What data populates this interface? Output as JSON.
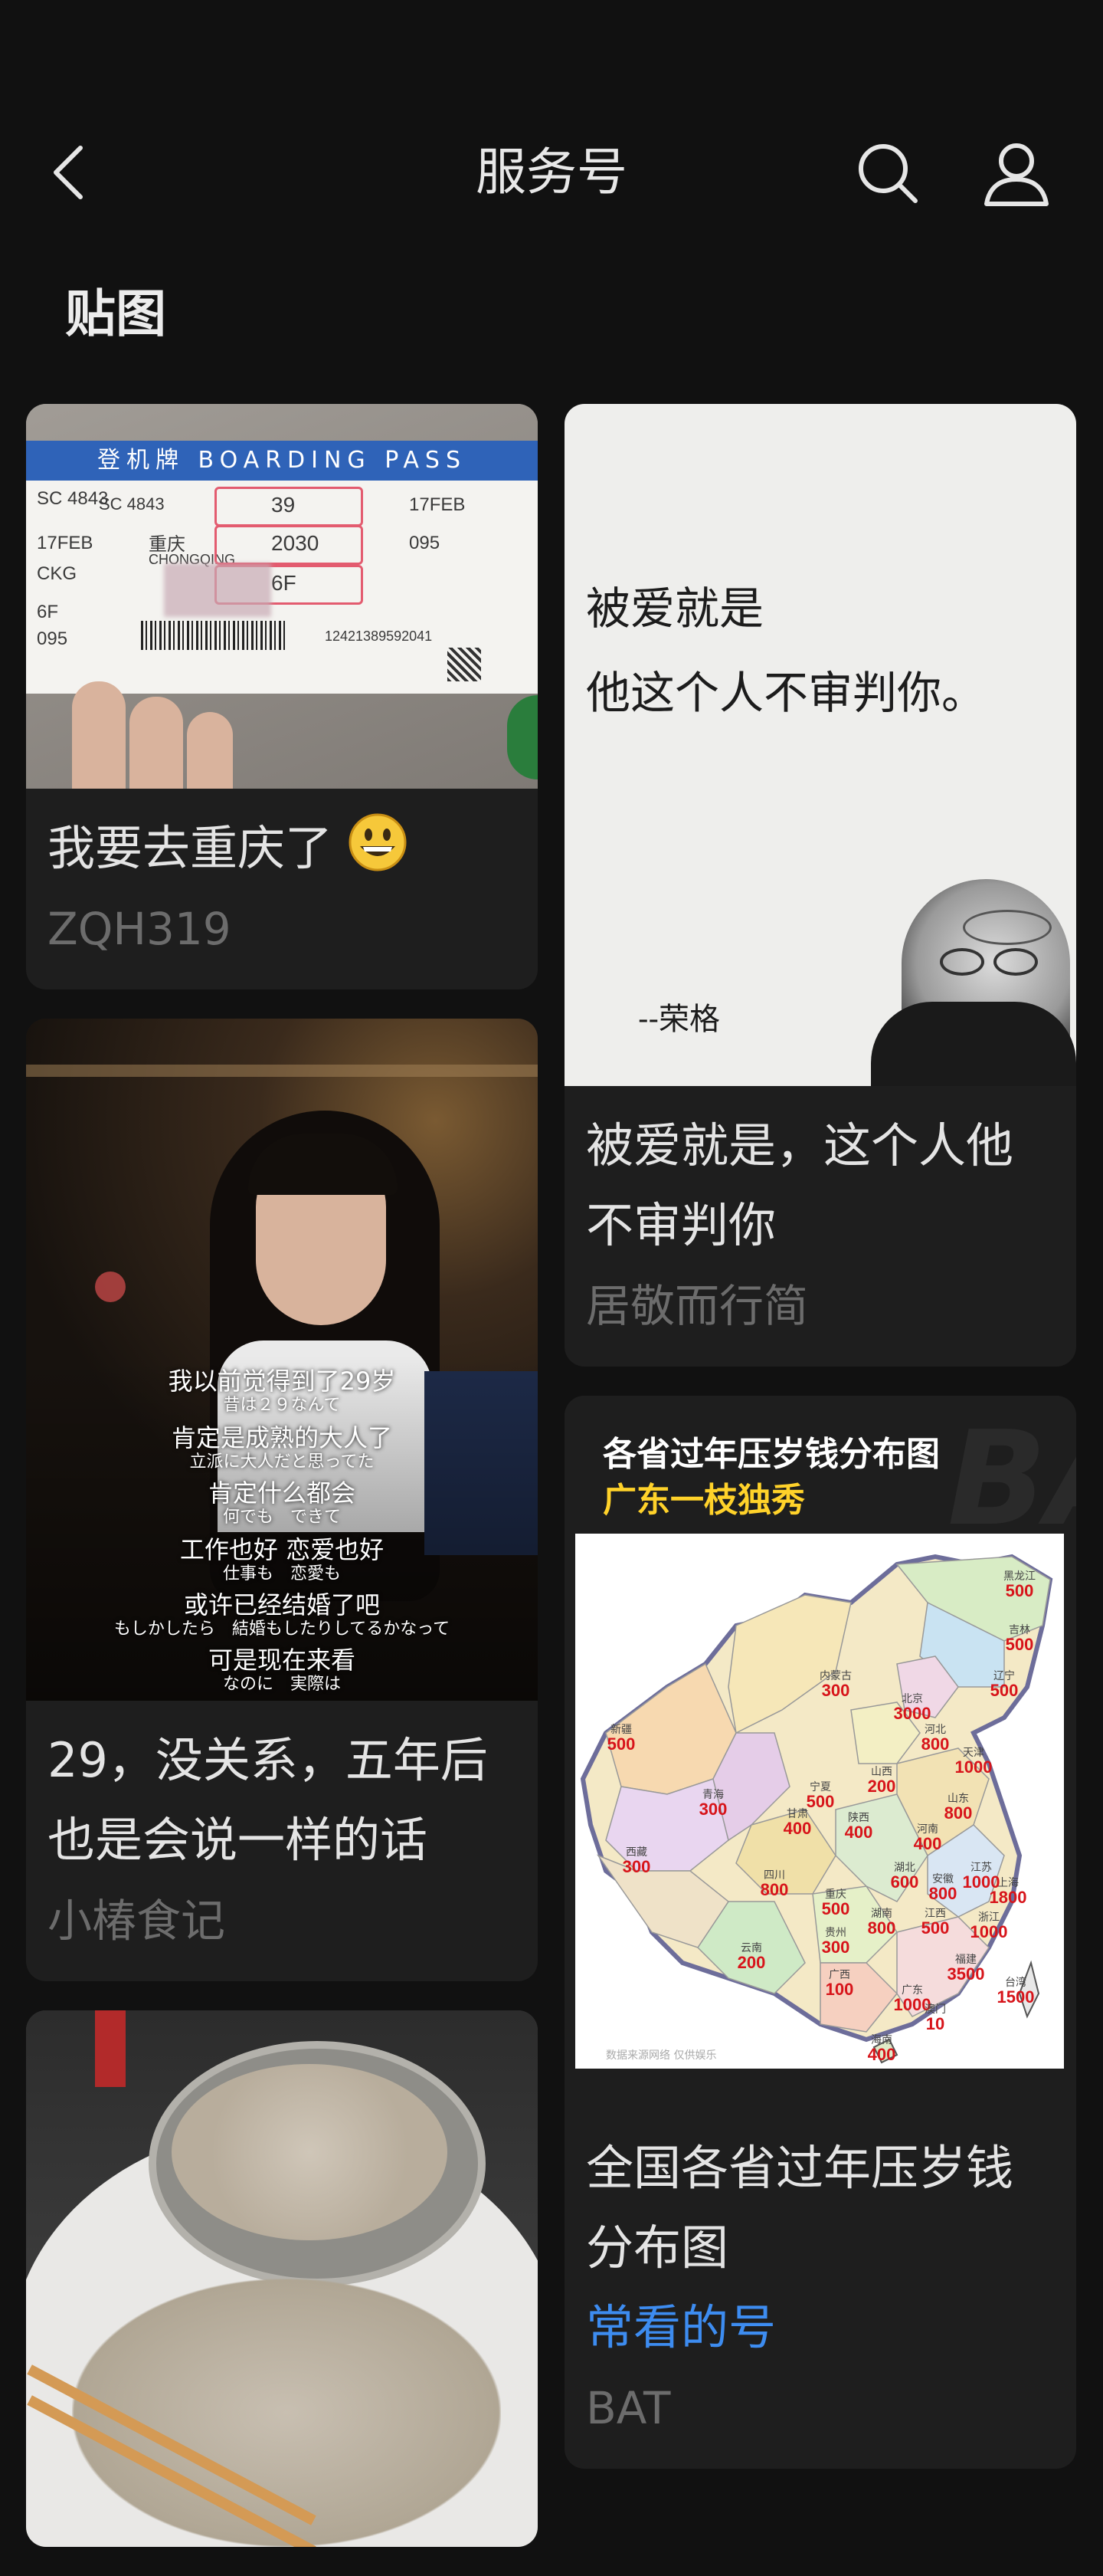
{
  "header": {
    "title": "服务号",
    "back_icon": "chevron-left-icon",
    "search_icon": "search-icon",
    "user_icon": "user-icon"
  },
  "section": {
    "title": "贴图"
  },
  "cards": {
    "ticket": {
      "title": "我要去重庆了",
      "emoji": "grinning-face-emoji",
      "author": "ZQH319"
    },
    "quote": {
      "title": "被爱就是，这个人他不审判你",
      "author": "居敬而行简"
    },
    "drama": {
      "title": "29，没关系，五年后也是会说一样的话",
      "author": "小椿食记"
    },
    "map": {
      "title": "全国各省过年压岁钱分布图",
      "tag": "常看的号",
      "author": "BAT"
    }
  },
  "ticket_img": {
    "header": "登机牌 BOARDING PASS",
    "flight": "SC 4843",
    "date": "17FEB",
    "dest_cn": "重庆",
    "dest_en": "CHONGQING",
    "gate": "39",
    "time": "2030",
    "seat": "6F",
    "seq": "095",
    "code": "CKG",
    "barcode_no": "12421389592041"
  },
  "quote_img": {
    "line1": "被爱就是",
    "line2": "他这个人不审判你。",
    "author": "--荣格"
  },
  "drama_img": {
    "lines": [
      {
        "cn": "我以前觉得到了29岁",
        "jp": "昔は２９なんて"
      },
      {
        "cn": "肯定是成熟的大人了",
        "jp": "立派に大人だと思ってた"
      },
      {
        "cn": "肯定什么都会",
        "jp": "何でも　できて"
      },
      {
        "cn": "工作也好 恋爱也好",
        "jp": "仕事も　恋愛も"
      },
      {
        "cn": "或许已经结婚了吧",
        "jp": "もしかしたら　結婚もしたりしてるかなって"
      },
      {
        "cn": "可是现在来看",
        "jp": "なのに　実際は"
      }
    ]
  },
  "map_img": {
    "title": "各省过年压岁钱分布图",
    "subtitle": "广东一枝独秀",
    "watermark": "BAT",
    "provinces": [
      {
        "name": "新疆",
        "value": "500"
      },
      {
        "name": "西藏",
        "value": "300"
      },
      {
        "name": "青海",
        "value": "300"
      },
      {
        "name": "甘肃",
        "value": "400"
      },
      {
        "name": "内蒙古",
        "value": "300"
      },
      {
        "name": "宁夏",
        "value": "500"
      },
      {
        "name": "陕西",
        "value": "400"
      },
      {
        "name": "山西",
        "value": "200"
      },
      {
        "name": "四川",
        "value": "800"
      },
      {
        "name": "重庆",
        "value": "500"
      },
      {
        "name": "贵州",
        "value": "300"
      },
      {
        "name": "云南",
        "value": "200"
      },
      {
        "name": "广西",
        "value": "100"
      },
      {
        "name": "湖南",
        "value": "800"
      },
      {
        "name": "湖北",
        "value": "600"
      },
      {
        "name": "河南",
        "value": "400"
      },
      {
        "name": "江西",
        "value": "500"
      },
      {
        "name": "广东",
        "value": "1000"
      },
      {
        "name": "海南",
        "value": "400"
      },
      {
        "name": "福建",
        "value": "3500"
      },
      {
        "name": "浙江",
        "value": "1000"
      },
      {
        "name": "上海",
        "value": "1800"
      },
      {
        "name": "江苏",
        "value": "1000"
      },
      {
        "name": "安徽",
        "value": "800"
      },
      {
        "name": "山东",
        "value": "800"
      },
      {
        "name": "河北",
        "value": "800"
      },
      {
        "name": "北京",
        "value": "3000"
      },
      {
        "name": "天津",
        "value": "1000"
      },
      {
        "name": "辽宁",
        "value": "500"
      },
      {
        "name": "吉林",
        "value": "500"
      },
      {
        "name": "黑龙江",
        "value": "500"
      },
      {
        "name": "台湾",
        "value": "1500"
      },
      {
        "name": "澳门",
        "value": "10"
      }
    ]
  }
}
